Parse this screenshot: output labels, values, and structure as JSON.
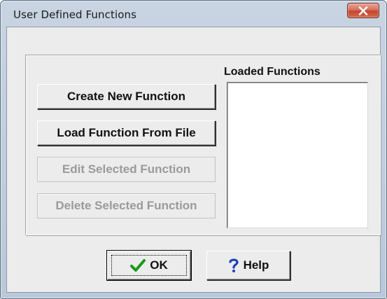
{
  "window": {
    "title": "User Defined Functions"
  },
  "buttons": {
    "create": "Create New Function",
    "load": "Load Function From File",
    "edit": "Edit Selected Function",
    "delete": "Delete Selected Function"
  },
  "loaded_functions": {
    "label": "Loaded Functions",
    "items": []
  },
  "dialog_buttons": {
    "ok": "OK",
    "help": "Help"
  },
  "icons": {
    "close": "close-icon",
    "ok": "checkmark-icon",
    "help": "question-mark-icon"
  },
  "colors": {
    "check_green": "#1a9a1a",
    "help_blue": "#1a3fb8",
    "close_red": "#c2452d",
    "disabled_text": "#9a9a9a"
  }
}
